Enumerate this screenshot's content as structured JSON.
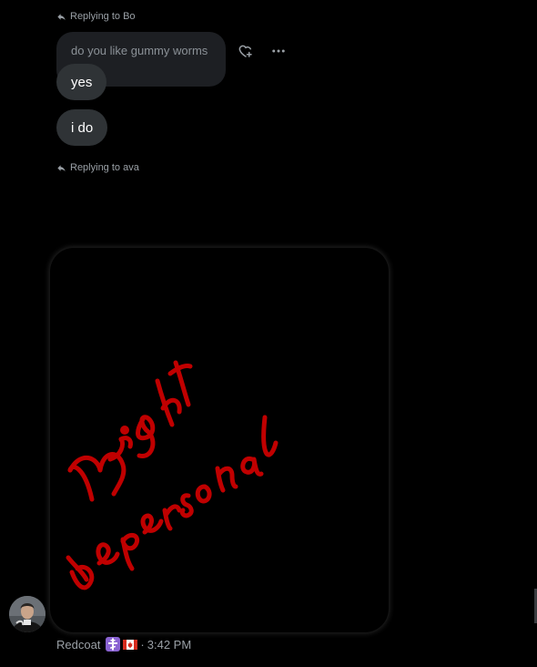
{
  "thread": {
    "reply_to_bo": "Replying to Bo",
    "quoted_message": "do you like gummy worms",
    "message_yes": "yes",
    "message_ido": "i do",
    "reply_to_ava": "Replying to ava"
  },
  "media": {
    "scribble_text_line1": "Might",
    "scribble_text_line2": "be personal",
    "scribble_color": "#c00000"
  },
  "author": {
    "name": "Redcoat",
    "separator": "·",
    "time": "3:42 PM",
    "badge_icons": [
      "orthodox-cross-icon",
      "canada-flag-icon"
    ]
  },
  "colors": {
    "background": "#000000",
    "bubble": "#2f3336",
    "quoted_bubble": "#1d1f23",
    "secondary_text": "#9aa0a6",
    "badge_purple": "#8a63d2",
    "canada_red": "#d52b1e"
  }
}
